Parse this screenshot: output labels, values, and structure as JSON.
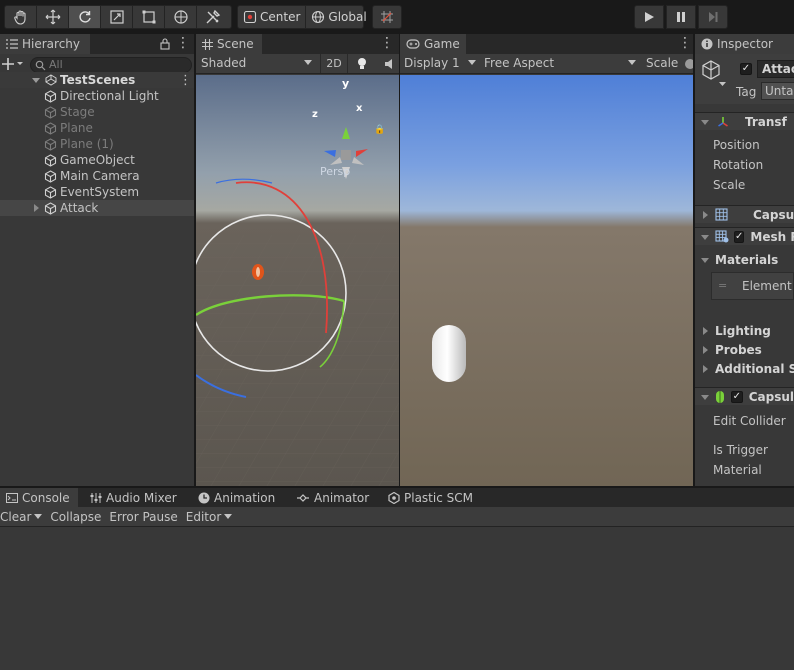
{
  "toolbar": {
    "pivot_label": "Center",
    "space_label": "Global"
  },
  "hierarchy": {
    "tab_label": "Hierarchy",
    "search_placeholder": "All",
    "scene_name": "TestScenes",
    "items": [
      {
        "label": "Directional Light",
        "dim": false
      },
      {
        "label": "Stage",
        "dim": true
      },
      {
        "label": "Plane",
        "dim": true
      },
      {
        "label": "Plane (1)",
        "dim": true
      },
      {
        "label": "GameObject",
        "dim": false
      },
      {
        "label": "Main Camera",
        "dim": false
      },
      {
        "label": "EventSystem",
        "dim": false
      },
      {
        "label": "Attack",
        "dim": false,
        "selected": true
      }
    ]
  },
  "scene": {
    "tab_label": "Scene",
    "shading_mode": "Shaded",
    "mode_2d_label": "2D",
    "gizmo_y": "y",
    "gizmo_x": "x",
    "gizmo_z": "z",
    "projection_label": "Persp"
  },
  "game": {
    "tab_label": "Game",
    "display": "Display 1",
    "aspect": "Free Aspect",
    "scale_label": "Scale"
  },
  "inspector": {
    "tab_label": "Inspector",
    "object_name": "Attac",
    "tag_label": "Tag",
    "tag_value": "Unta",
    "transform_label": "Transf",
    "position_label": "Position",
    "rotation_label": "Rotation",
    "scale_label": "Scale",
    "capsule_filter_label": "Capsul",
    "mesh_renderer_label": "Mesh R",
    "materials_label": "Materials",
    "element_label": "Element (",
    "lighting_label": "Lighting",
    "probes_label": "Probes",
    "additional_label": "Additional Set",
    "capsule_collider_label": "Capsul",
    "edit_collider_label": "Edit Collider",
    "is_trigger_label": "Is Trigger",
    "material_label": "Material"
  },
  "bottom_tabs": {
    "console": "Console",
    "audio_mixer": "Audio Mixer",
    "animation": "Animation",
    "animator": "Animator",
    "plastic_scm": "Plastic SCM"
  },
  "console": {
    "clear_label": "Clear",
    "collapse_label": "Collapse",
    "error_pause_label": "Error Pause",
    "editor_label": "Editor"
  },
  "colors": {
    "accent_blue": "#3a79bb",
    "panel_bg": "#383838",
    "gizmo_y": "#7ad13a",
    "gizmo_x": "#e0403a",
    "gizmo_z": "#3a6fe0"
  }
}
